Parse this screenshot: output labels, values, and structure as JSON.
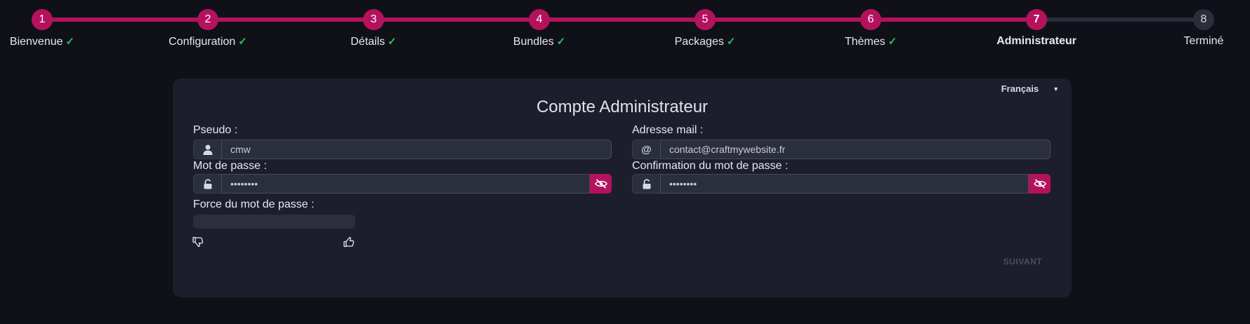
{
  "stepper": {
    "steps": [
      {
        "number": "1",
        "label": "Bienvenue",
        "done": true
      },
      {
        "number": "2",
        "label": "Configuration",
        "done": true
      },
      {
        "number": "3",
        "label": "Détails",
        "done": true
      },
      {
        "number": "4",
        "label": "Bundles",
        "done": true
      },
      {
        "number": "5",
        "label": "Packages",
        "done": true
      },
      {
        "number": "6",
        "label": "Thèmes",
        "done": true
      },
      {
        "number": "7",
        "label": "Administrateur",
        "done": false,
        "active": true
      },
      {
        "number": "8",
        "label": "Terminé",
        "done": false
      }
    ],
    "check_glyph": "✓"
  },
  "card": {
    "language": "Français",
    "title": "Compte Administrateur",
    "pseudo": {
      "label": "Pseudo :",
      "value": "cmw",
      "icon": "user-icon"
    },
    "email": {
      "label": "Adresse mail :",
      "value": "contact@craftmywebsite.fr",
      "icon": "at-icon"
    },
    "password": {
      "label": "Mot de passe :",
      "value": "••••••••",
      "icon": "unlock-icon"
    },
    "password_confirm": {
      "label": "Confirmation du mot de passe :",
      "value": "••••••••",
      "icon": "unlock-icon"
    },
    "strength": {
      "label": "Force du mot de passe :",
      "value": 0
    },
    "next_label": "SUIVANT"
  },
  "colors": {
    "accent": "#b5125e",
    "success": "#22c55e",
    "card_bg": "#1d1e2c",
    "page_bg": "#0f1018"
  }
}
